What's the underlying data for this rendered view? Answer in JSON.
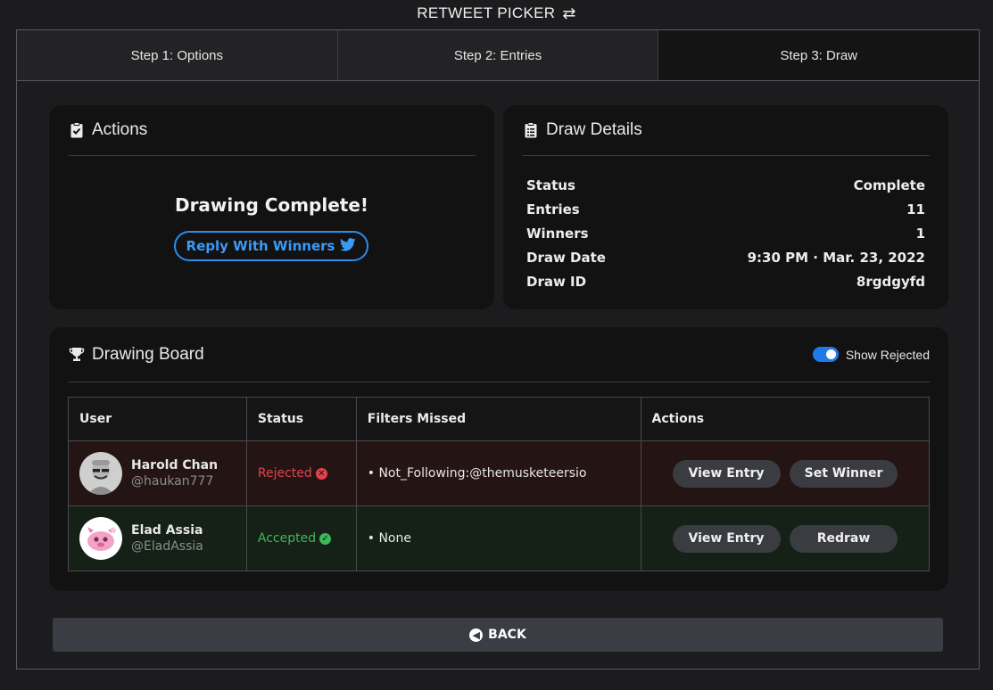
{
  "app": {
    "title": "RETWEET PICKER",
    "title_icon": "retweet-icon"
  },
  "tabs": [
    {
      "label": "Step 1: Options",
      "active": false
    },
    {
      "label": "Step 2: Entries",
      "active": false
    },
    {
      "label": "Step 3: Draw",
      "active": true
    }
  ],
  "actions_card": {
    "title": "Actions",
    "icon": "clipboard-check-icon",
    "message": "Drawing Complete!",
    "reply_button": "Reply With Winners",
    "reply_icon": "twitter-bird-icon"
  },
  "details_card": {
    "title": "Draw Details",
    "icon": "clipboard-list-icon",
    "rows": [
      {
        "label": "Status",
        "value": "Complete"
      },
      {
        "label": "Entries",
        "value": "11"
      },
      {
        "label": "Winners",
        "value": "1"
      },
      {
        "label": "Draw Date",
        "value": "9:30 PM · Mar. 23, 2022"
      },
      {
        "label": "Draw ID",
        "value": "8rgdgyfd"
      }
    ]
  },
  "board": {
    "title": "Drawing Board",
    "icon": "trophy-icon",
    "toggle_label": "Show Rejected",
    "toggle_on": true,
    "columns": [
      "User",
      "Status",
      "Filters Missed",
      "Actions"
    ],
    "rows": [
      {
        "name": "Harold Chan",
        "handle": "@haukan777",
        "status": "Rejected",
        "filters": "• Not_Following:@themusketeersio",
        "button1": "View Entry",
        "button2": "Set Winner"
      },
      {
        "name": "Elad Assia",
        "handle": "@EladAssia",
        "status": "Accepted",
        "filters": "• None",
        "button1": "View Entry",
        "button2": "Redraw"
      }
    ]
  },
  "back_button": "BACK",
  "colors": {
    "accent_blue": "#2b8cf0",
    "rejected": "#e2434e",
    "accepted": "#3cb85a",
    "background": "#1c1c1e",
    "card": "#121213"
  }
}
